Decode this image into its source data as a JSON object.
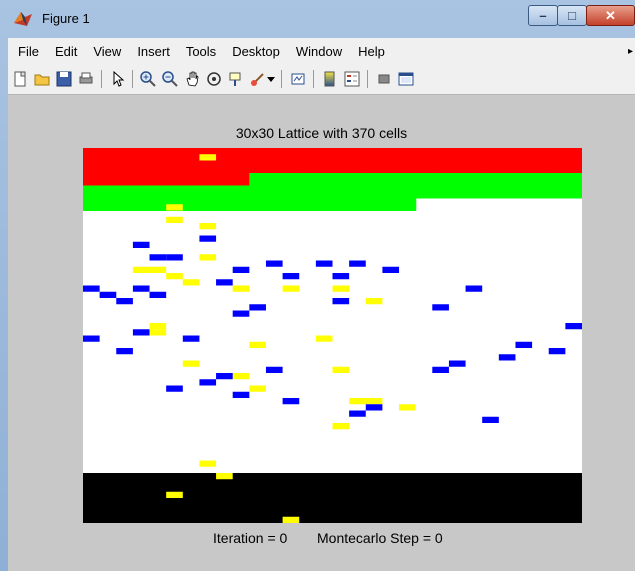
{
  "window": {
    "title": "Figure 1",
    "minimize": "–",
    "maximize": "□",
    "close": "✕"
  },
  "menu": [
    "File",
    "Edit",
    "View",
    "Insert",
    "Tools",
    "Desktop",
    "Window",
    "Help"
  ],
  "menu_overflow": "▸",
  "toolbar": [
    "new-figure-icon",
    "open-file-icon",
    "save-icon",
    "print-icon",
    "pointer-icon",
    "zoom-in-icon",
    "zoom-out-icon",
    "pan-icon",
    "rotate-3d-icon",
    "data-cursor-icon",
    "brush-icon",
    "dropdown-arrow-icon",
    "link-plot-icon",
    "colorbar-icon",
    "legend-icon",
    "hide-plot-tools-icon",
    "show-plot-tools-icon"
  ],
  "plot": {
    "title": "30x30 Lattice with 370 cells"
  },
  "status": {
    "iteration": "Iteration = 0",
    "montecarlo": "Montecarlo Step = 0"
  },
  "colors": {
    "red": "#ff0000",
    "green": "#00ff00",
    "white": "#ffffff",
    "black": "#000000",
    "yellow": "#ffff00",
    "blue": "#0000ff"
  },
  "lattice": {
    "size": 30,
    "red_bottom_row_by_col": [
      2,
      2,
      2,
      2,
      2,
      2,
      2,
      2,
      2,
      2,
      1,
      1,
      1,
      1,
      1,
      1,
      1,
      1,
      1,
      1,
      1,
      1,
      1,
      1,
      1,
      1,
      1,
      1,
      1,
      1
    ],
    "green_bottom_row_by_col": [
      4,
      4,
      4,
      4,
      4,
      4,
      4,
      4,
      4,
      4,
      4,
      4,
      4,
      4,
      4,
      4,
      4,
      4,
      4,
      4,
      3,
      3,
      3,
      3,
      3,
      3,
      3,
      3,
      3,
      3
    ],
    "black_start_row": 26,
    "yellow": [
      [
        1,
        7
      ],
      [
        9,
        5
      ],
      [
        11,
        5
      ],
      [
        12,
        7
      ],
      [
        17,
        7
      ],
      [
        19,
        4
      ],
      [
        19,
        3
      ],
      [
        20,
        5
      ],
      [
        21,
        6
      ],
      [
        22,
        9
      ],
      [
        22,
        15
      ],
      [
        22,
        12
      ],
      [
        24,
        17
      ],
      [
        28,
        4
      ],
      [
        29,
        4
      ],
      [
        30,
        14
      ],
      [
        31,
        10
      ],
      [
        34,
        6
      ],
      [
        35,
        15
      ],
      [
        36,
        9
      ],
      [
        38,
        10
      ],
      [
        40,
        16
      ],
      [
        40,
        17
      ],
      [
        41,
        19
      ],
      [
        44,
        15
      ],
      [
        50,
        7
      ],
      [
        52,
        8
      ],
      [
        55,
        5
      ],
      [
        59,
        12
      ]
    ],
    "blue": [
      [
        14,
        7
      ],
      [
        15,
        3
      ],
      [
        17,
        4
      ],
      [
        17,
        5
      ],
      [
        18,
        11
      ],
      [
        18,
        14
      ],
      [
        18,
        16
      ],
      [
        19,
        9
      ],
      [
        19,
        18
      ],
      [
        20,
        12
      ],
      [
        20,
        15
      ],
      [
        21,
        8
      ],
      [
        22,
        0
      ],
      [
        22,
        3
      ],
      [
        22,
        23
      ],
      [
        23,
        1
      ],
      [
        23,
        4
      ],
      [
        24,
        2
      ],
      [
        24,
        15
      ],
      [
        25,
        10
      ],
      [
        25,
        21
      ],
      [
        26,
        9
      ],
      [
        28,
        29
      ],
      [
        29,
        3
      ],
      [
        30,
        0
      ],
      [
        30,
        6
      ],
      [
        31,
        26
      ],
      [
        32,
        2
      ],
      [
        32,
        28
      ],
      [
        33,
        25
      ],
      [
        34,
        22
      ],
      [
        35,
        21
      ],
      [
        35,
        11
      ],
      [
        36,
        8
      ],
      [
        37,
        7
      ],
      [
        38,
        5
      ],
      [
        39,
        9
      ],
      [
        40,
        12
      ],
      [
        41,
        17
      ],
      [
        42,
        16
      ],
      [
        43,
        24
      ]
    ]
  }
}
